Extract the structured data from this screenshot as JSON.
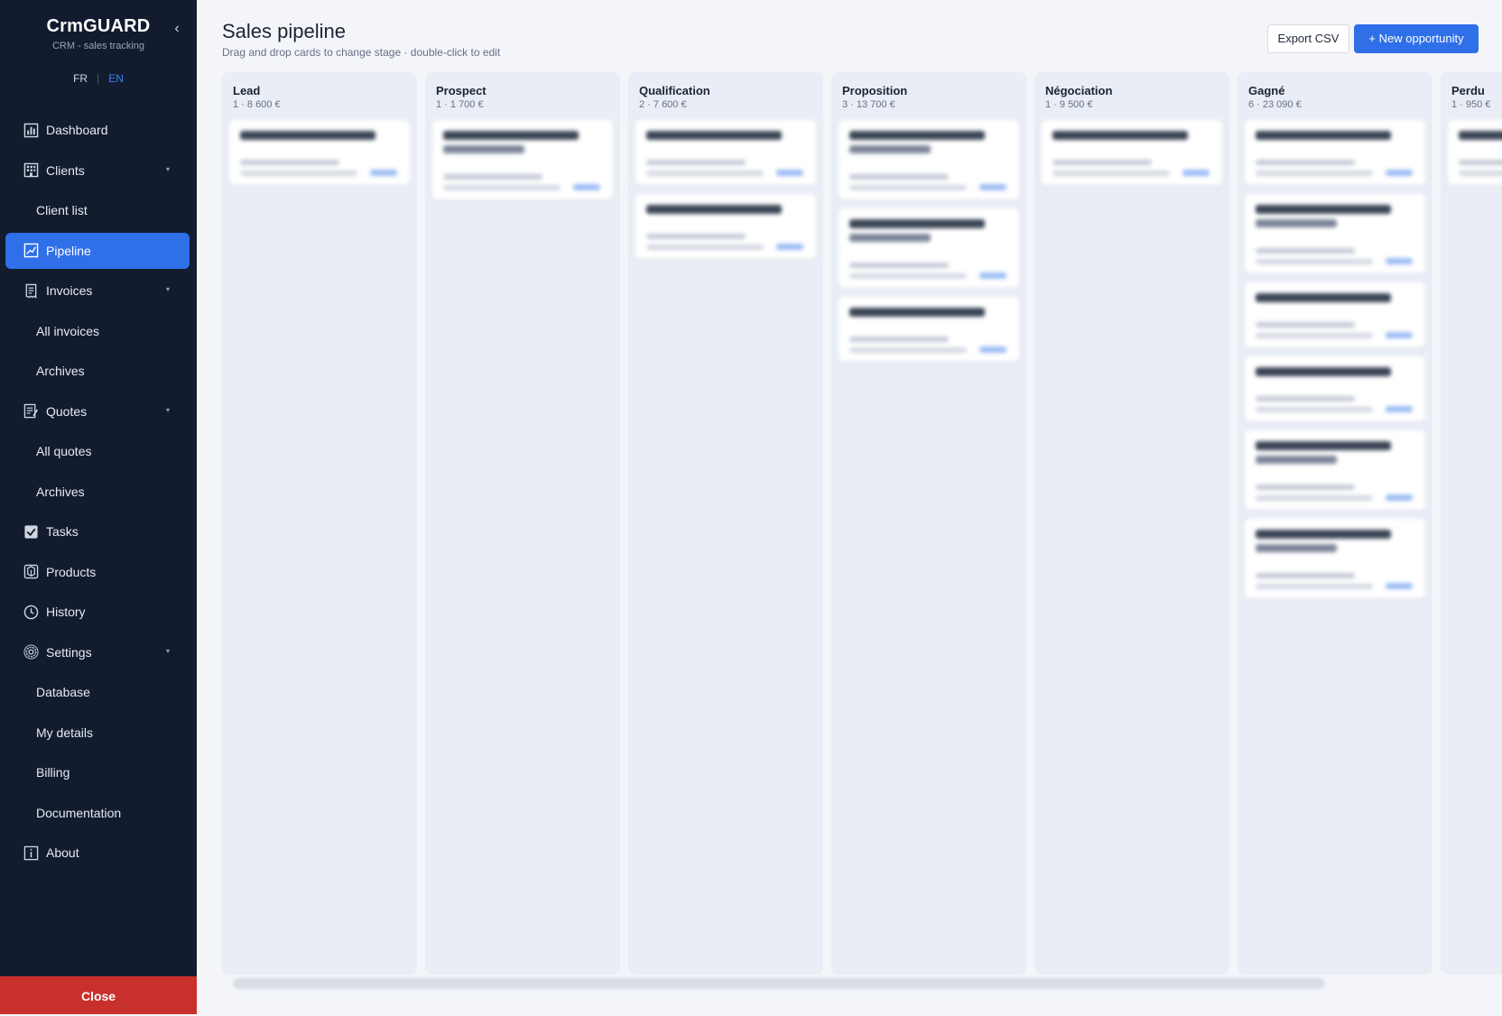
{
  "sidebar": {
    "brand_title": "CrmGUARD",
    "brand_subtitle": "CRM - sales tracking",
    "collapse_glyph": "‹",
    "lang_fr": "FR",
    "lang_sep": "|",
    "lang_en": "EN",
    "items": [
      {
        "label": "Dashboard",
        "icon": "chart-bar-icon"
      },
      {
        "label": "Clients",
        "icon": "building-icon",
        "caret": "▾"
      },
      {
        "label": "Client list"
      },
      {
        "label": "Pipeline",
        "icon": "pipeline-icon"
      },
      {
        "label": "Invoices",
        "icon": "receipt-icon",
        "caret": "▾"
      },
      {
        "label": "All invoices"
      },
      {
        "label": "Archives"
      },
      {
        "label": "Quotes",
        "icon": "quote-icon",
        "caret": "▾"
      },
      {
        "label": "All quotes"
      },
      {
        "label": "Archives"
      },
      {
        "label": "Tasks",
        "icon": "checkbox-icon"
      },
      {
        "label": "Products",
        "icon": "box-icon"
      },
      {
        "label": "History",
        "icon": "clock-icon"
      },
      {
        "label": "Settings",
        "icon": "gear-icon",
        "caret": "▾"
      },
      {
        "label": "Database"
      },
      {
        "label": "My details"
      },
      {
        "label": "Billing"
      },
      {
        "label": "Documentation"
      },
      {
        "label": "About",
        "icon": "info-icon"
      }
    ],
    "close_label": "Close"
  },
  "header": {
    "title": "Sales pipeline",
    "subtitle": "Drag and drop cards to change stage · double-click to edit",
    "export_label": "Export CSV",
    "new_label": "+ New opportunity"
  },
  "colors": {
    "sidebar_bg": "#121c2e",
    "accent": "#2f6fe8",
    "close_bg": "#c8302b",
    "column_bg": "#e9edf5",
    "page_bg": "#f3f5f9"
  },
  "columns": [
    {
      "title": "Lead",
      "meta": "1 · 8 600 €",
      "cards": 1
    },
    {
      "title": "Prospect",
      "meta": "1 · 1 700 €",
      "cards": 1
    },
    {
      "title": "Qualification",
      "meta": "2 · 7 600 €",
      "cards": 2
    },
    {
      "title": "Proposition",
      "meta": "3 · 13 700 €",
      "cards": 3
    },
    {
      "title": "Négociation",
      "meta": "1 · 9 500 €",
      "cards": 1
    },
    {
      "title": "Gagné",
      "meta": "6 · 23 090 €",
      "cards": 6
    },
    {
      "title": "Perdu",
      "meta": "1 · 950 €",
      "cards": 1
    }
  ]
}
